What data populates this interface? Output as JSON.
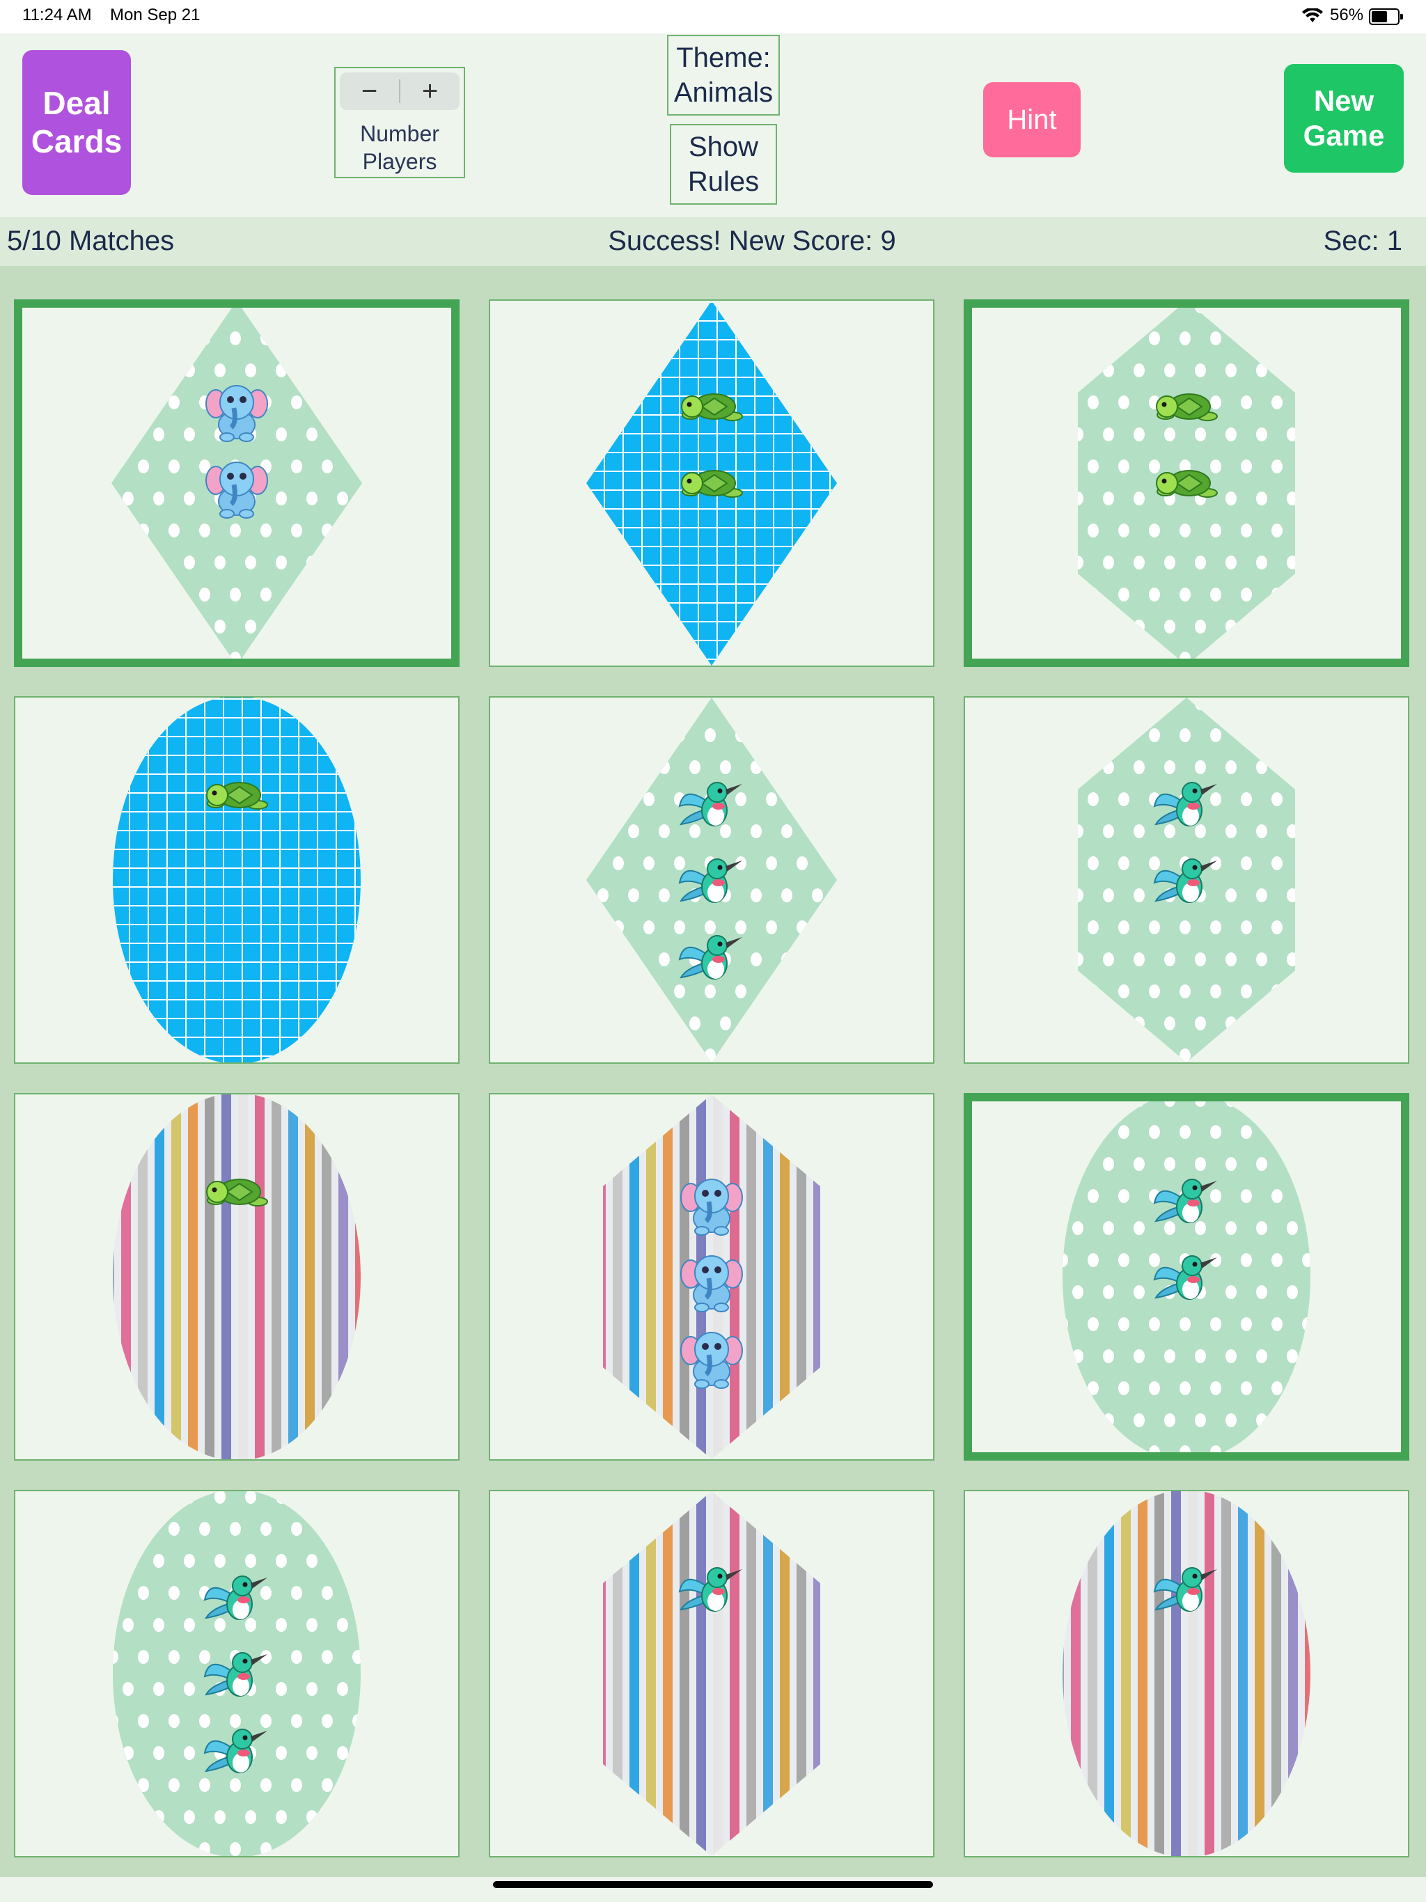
{
  "status_bar": {
    "time": "11:24 AM",
    "date": "Mon Sep 21",
    "battery": "56%"
  },
  "toolbar": {
    "deal_label": "Deal Cards",
    "players_minus": "−",
    "players_plus": "+",
    "players_label": "Number Players",
    "theme_label": "Theme: Animals",
    "rules_label": "Show Rules",
    "hint_label": "Hint",
    "new_game_label": "New Game",
    "colors": {
      "deal": "#af52de",
      "hint": "#ff6b9b",
      "new_game": "#1fc665"
    }
  },
  "info": {
    "matches": "5/10 Matches",
    "message": "Success!  New Score: 9",
    "timer": "Sec: 1"
  },
  "cards": [
    {
      "shape": "diamond",
      "pattern": "dots",
      "animal": "elephant",
      "count": 2,
      "selected": true
    },
    {
      "shape": "diamond",
      "pattern": "grid",
      "animal": "turtle",
      "count": 2,
      "selected": false
    },
    {
      "shape": "hexagon",
      "pattern": "dots",
      "animal": "turtle",
      "count": 2,
      "selected": true
    },
    {
      "shape": "oval",
      "pattern": "grid",
      "animal": "turtle",
      "count": 1,
      "selected": false
    },
    {
      "shape": "diamond",
      "pattern": "dots",
      "animal": "hummingbird",
      "count": 3,
      "selected": false
    },
    {
      "shape": "hexagon",
      "pattern": "dots",
      "animal": "hummingbird",
      "count": 2,
      "selected": false
    },
    {
      "shape": "oval",
      "pattern": "stripes",
      "animal": "turtle",
      "count": 1,
      "selected": false
    },
    {
      "shape": "hexagon",
      "pattern": "stripes",
      "animal": "elephant",
      "count": 3,
      "selected": false
    },
    {
      "shape": "oval",
      "pattern": "dots",
      "animal": "hummingbird",
      "count": 2,
      "selected": true
    },
    {
      "shape": "oval",
      "pattern": "dots",
      "animal": "hummingbird",
      "count": 3,
      "selected": false
    },
    {
      "shape": "hexagon",
      "pattern": "stripes",
      "animal": "hummingbird",
      "count": 1,
      "selected": false
    },
    {
      "shape": "oval",
      "pattern": "stripes",
      "animal": "hummingbird",
      "count": 1,
      "selected": false
    }
  ],
  "colors": {
    "dots_bg": "#b3dfc5",
    "grid_bg": "#0fb4f2",
    "selected_border": "#43a454"
  }
}
